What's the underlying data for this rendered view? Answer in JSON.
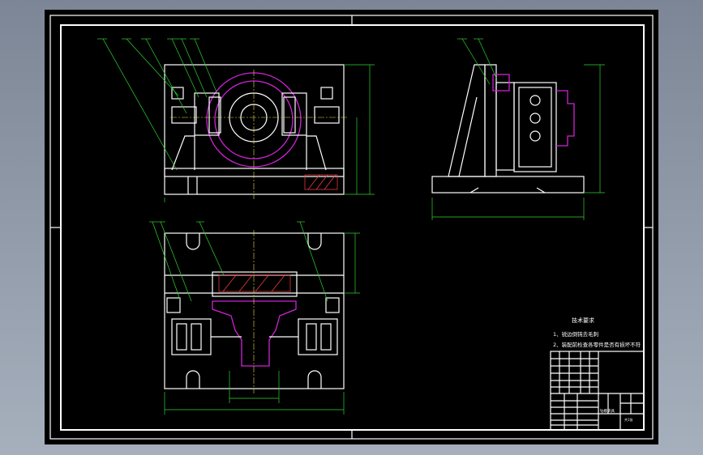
{
  "drawing": {
    "tech_requirements": {
      "title": "技术要求",
      "items": [
        "1、锐边倒钝去毛刺",
        "2、装配前检查各零件是否有损坏不符"
      ]
    },
    "title_block": {
      "drawing_name": "钻模夹具",
      "sheet_label": "共1张"
    },
    "colors": {
      "background": "#000000",
      "outline": "#ffffff",
      "workpiece": "#d023d6",
      "dimension": "#2fd52f",
      "hatch": "#ff4040"
    }
  }
}
